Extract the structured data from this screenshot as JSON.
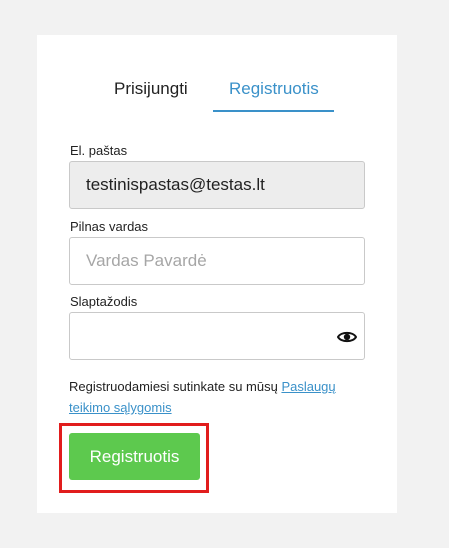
{
  "tabs": {
    "login_label": "Prisijungti",
    "register_label": "Registruotis",
    "active": "register"
  },
  "form": {
    "email_label": "El. paštas",
    "email_value": "testinispastas@testas.lt",
    "name_label": "Pilnas vardas",
    "name_placeholder": "Vardas Pavardė",
    "password_label": "Slaptažodis",
    "password_value": "",
    "eye_icon": "eye-icon",
    "terms_text": "Registruodamiesi sutinkate su mūsų ",
    "terms_link": "Paslaugų teikimo sąlygomis",
    "submit_label": "Registruotis"
  },
  "colors": {
    "accent": "#3a91c9",
    "button": "#5dc94e",
    "highlight": "#e11d1d"
  }
}
